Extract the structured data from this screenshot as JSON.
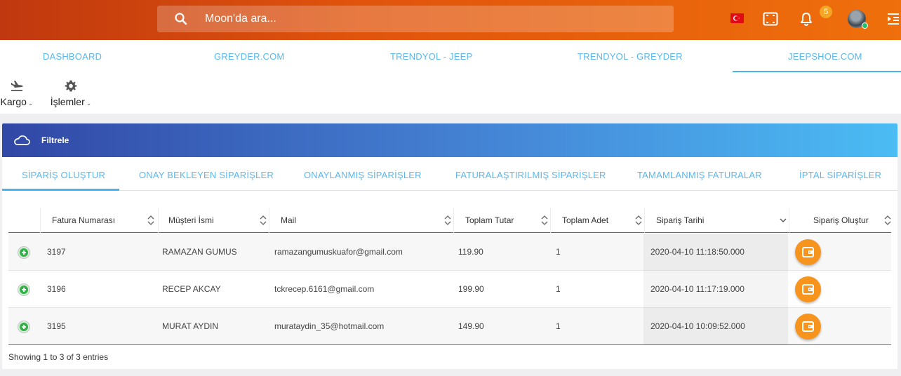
{
  "header": {
    "search_placeholder": "Moon'da ara...",
    "notification_count": "5",
    "colors": {
      "bar_start": "#c0380f",
      "bar_end": "#ef6f0c"
    }
  },
  "nav_tabs": [
    {
      "label": "DASHBOARD",
      "active": false
    },
    {
      "label": "GREYDER.COM",
      "active": false
    },
    {
      "label": "TRENDYOL - JEEP",
      "active": false
    },
    {
      "label": "TRENDYOL - GREYDER",
      "active": false
    },
    {
      "label": "JEEPSHOE.COM",
      "active": true
    }
  ],
  "toolbar": {
    "kargo_label": "Kargo",
    "islemler_label": "İşlemler"
  },
  "filter": {
    "title": "Filtrele"
  },
  "order_tabs": [
    {
      "label": "SİPARİŞ OLUŞTUR",
      "active": true
    },
    {
      "label": "ONAY BEKLEYEN SİPARİŞLER",
      "active": false
    },
    {
      "label": "ONAYLANMIŞ SİPARİŞLER",
      "active": false
    },
    {
      "label": "FATURALAŞTIRILMIŞ SİPARİŞLER",
      "active": false
    },
    {
      "label": "TAMAMLANMIŞ FATURALAR",
      "active": false
    },
    {
      "label": "İPTAL SİPARİŞLER",
      "active": false
    }
  ],
  "table": {
    "columns": [
      "Fatura Numarası",
      "Müşteri İsmi",
      "Mail",
      "Toplam Tutar",
      "Toplam Adet",
      "Sipariş Tarihi",
      "Sipariş Oluştur"
    ],
    "rows": [
      {
        "invoice": "3197",
        "customer": "RAMAZAN GUMUS",
        "mail": "ramazangumuskuafor@gmail.com",
        "total": "119.90",
        "qty": "1",
        "date": "2020-04-10 11:18:50.000"
      },
      {
        "invoice": "3196",
        "customer": "RECEP AKCAY",
        "mail": "tckrecep.6161@gmail.com",
        "total": "199.90",
        "qty": "1",
        "date": "2020-04-10 11:17:19.000"
      },
      {
        "invoice": "3195",
        "customer": "MURAT AYDIN",
        "mail": "murataydin_35@hotmail.com",
        "total": "149.90",
        "qty": "1",
        "date": "2020-04-10 10:09:52.000"
      }
    ],
    "footer": "Showing 1 to 3 of 3 entries"
  }
}
